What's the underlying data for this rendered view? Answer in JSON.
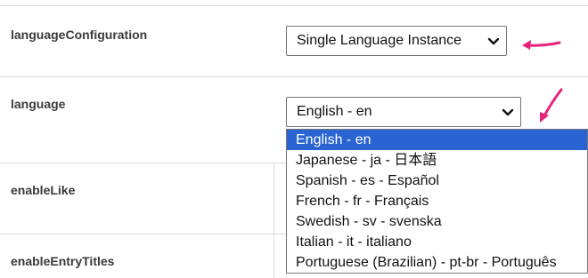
{
  "rows": [
    {
      "label": "languageConfiguration"
    },
    {
      "label": "language"
    },
    {
      "label": "enableLike"
    },
    {
      "label": "enableEntryTitles"
    }
  ],
  "language_config_select": {
    "value": "Single Language Instance"
  },
  "language_select": {
    "value": "English - en"
  },
  "language_options": [
    "English - en",
    "Japanese - ja - 日本語",
    "Spanish - es - Español",
    "French - fr - Français",
    "Swedish - sv - svenska",
    "Italian - it - italiano",
    "Portuguese (Brazilian) - pt-br - Português"
  ],
  "selected_option_index": 0,
  "icons": {
    "chevron": "chevron-down-icon",
    "annotation": "pink-arrow-icon",
    "annotation_color": "#e8237a",
    "highlight_color": "#2a64d2"
  }
}
